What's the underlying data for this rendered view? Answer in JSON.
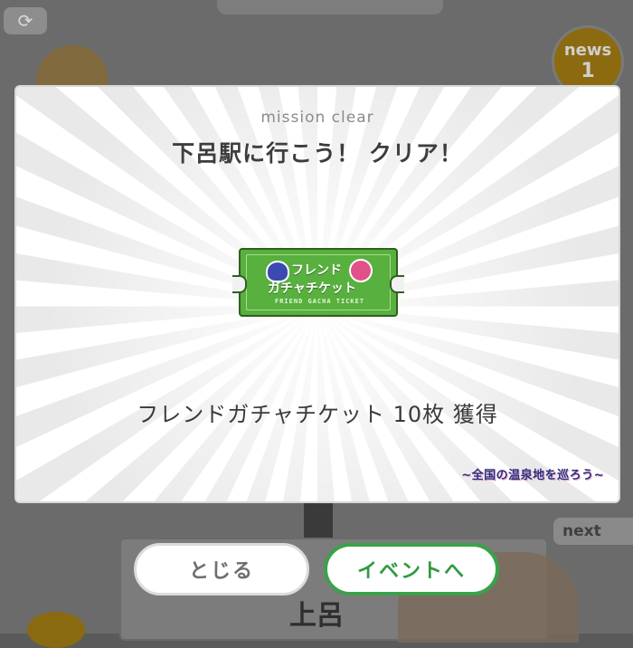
{
  "background": {
    "news_label": "news",
    "news_count": "1",
    "next_label": "next",
    "station_name": "上呂"
  },
  "dialog": {
    "mission_label": "mission clear",
    "title": "下呂駅に行こう！ クリア！",
    "ticket": {
      "line1": "フレンド",
      "line2": "ガチャチケット",
      "line3": "FRIEND GACHA TICKET",
      "color": "#58b03e"
    },
    "reward_text": "フレンドガチャチケット 10枚 獲得",
    "event_logo": "~全国の温泉地を巡ろう~"
  },
  "buttons": {
    "close_label": "とじる",
    "event_label": "イベントへ",
    "event_color": "#3aa24a"
  },
  "icons": [
    "sync-icon",
    "news-badge-icon",
    "friend-blue-face-icon",
    "friend-pink-face-icon"
  ]
}
